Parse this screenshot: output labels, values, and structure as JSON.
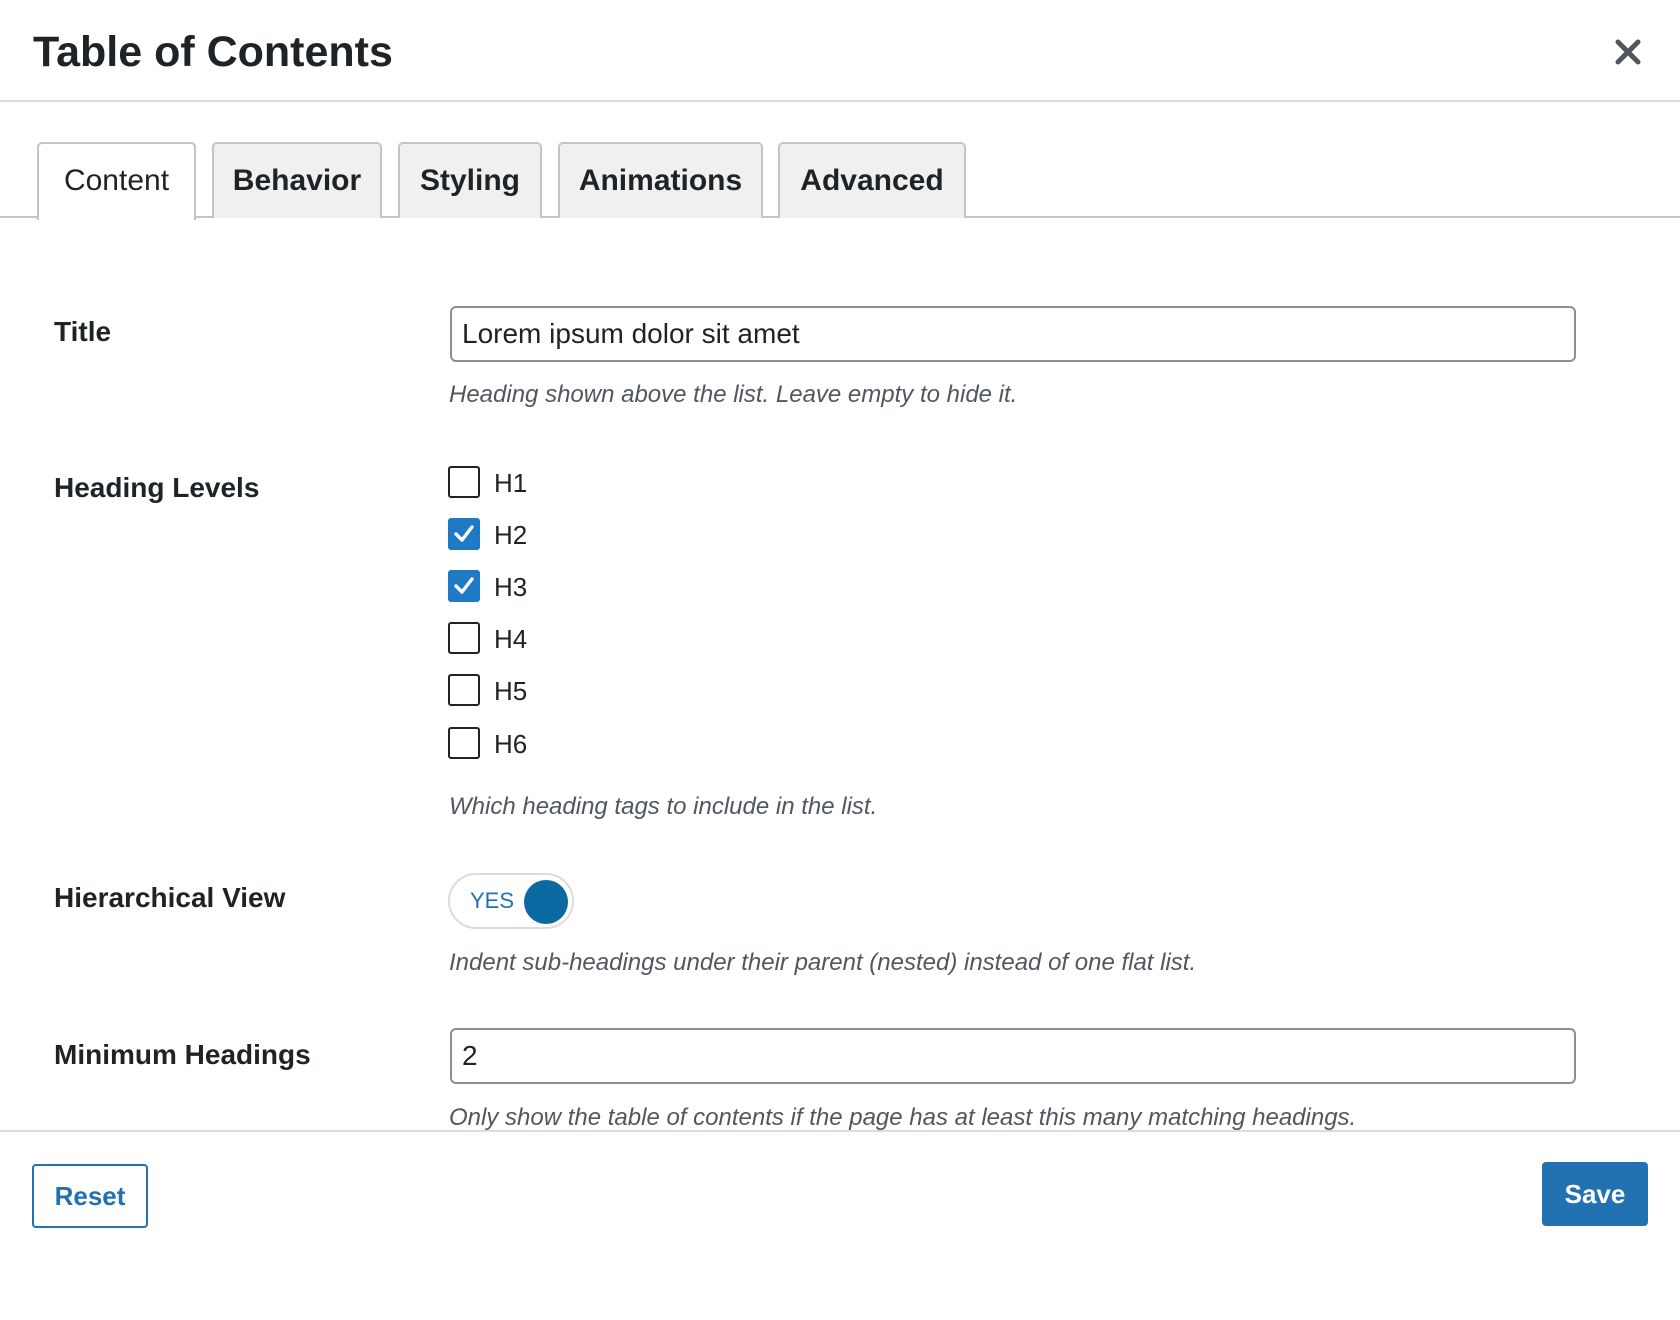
{
  "modal": {
    "title": "Table of Contents",
    "close_icon": "close-icon"
  },
  "tabs": [
    {
      "label": "Content",
      "active": true
    },
    {
      "label": "Behavior",
      "active": false
    },
    {
      "label": "Styling",
      "active": false
    },
    {
      "label": "Animations",
      "active": false
    },
    {
      "label": "Advanced",
      "active": false
    }
  ],
  "fields": {
    "title": {
      "label": "Title",
      "value": "Lorem ipsum dolor sit amet",
      "help": "Heading shown above the list. Leave empty to hide it."
    },
    "heading_levels": {
      "label": "Heading Levels",
      "options": [
        {
          "label": "H1",
          "checked": false
        },
        {
          "label": "H2",
          "checked": true
        },
        {
          "label": "H3",
          "checked": true
        },
        {
          "label": "H4",
          "checked": false
        },
        {
          "label": "H5",
          "checked": false
        },
        {
          "label": "H6",
          "checked": false
        }
      ],
      "help": "Which heading tags to include in the list."
    },
    "hierarchical_view": {
      "label": "Hierarchical View",
      "toggle_text": "YES",
      "enabled": true,
      "help": "Indent sub-headings under their parent (nested) instead of one flat list."
    },
    "minimum_headings": {
      "label": "Minimum Headings",
      "value": "2",
      "icon": "database-icon",
      "help": "Only show the table of contents if the page has at least this many matching headings."
    }
  },
  "footer": {
    "reset_label": "Reset",
    "save_label": "Save"
  },
  "colors": {
    "accent": "#2271b1",
    "checkbox_checked": "#1e7ac4",
    "toggle_knob": "#0a6aa1",
    "border": "#c3c4c7"
  }
}
